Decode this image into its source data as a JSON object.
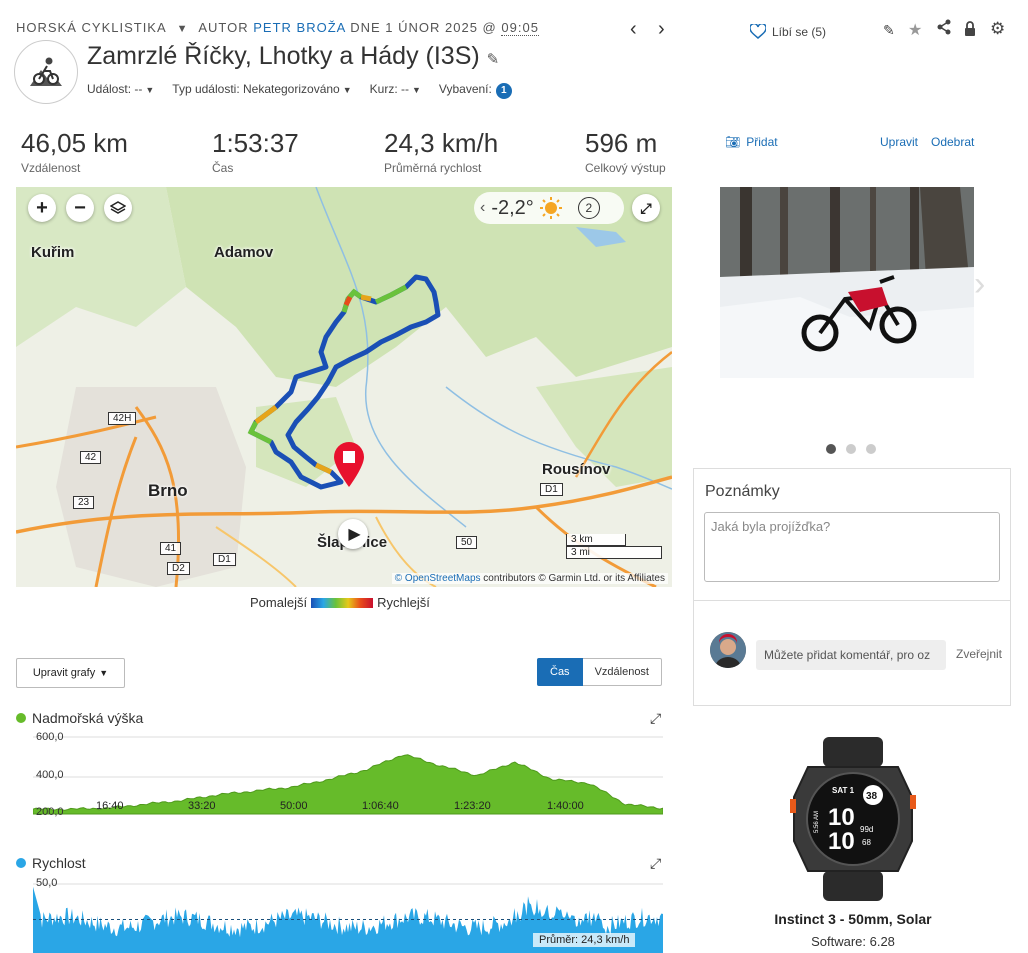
{
  "header": {
    "activity_type": "HORSKÁ CYKLISTIKA",
    "author_prefix": "AUTOR",
    "author_name": "PETR BROŽA",
    "date_text": "DNE 1 ÚNOR 2025 @",
    "time": "09:05",
    "title": "Zamrzlé Říčky, Lhotky a Hády (I3S)",
    "event_label": "Událost: --",
    "event_type_label": "Typ události: Nekategorizováno",
    "course_label": "Kurz: --",
    "gear_label": "Vybavení:",
    "gear_count": "1"
  },
  "stats": [
    {
      "value": "46,05 km",
      "label": "Vzdálenost"
    },
    {
      "value": "1:53:37",
      "label": "Čas"
    },
    {
      "value": "24,3 km/h",
      "label": "Průměrná rychlost"
    },
    {
      "value": "596 m",
      "label": "Celkový výstup"
    }
  ],
  "map": {
    "temperature": "-2,2°",
    "wind_level": "2",
    "places": [
      "Kuřim",
      "Adamov",
      "Brno",
      "Rousínov",
      "Šlapanice"
    ],
    "roads": [
      "42H",
      "42",
      "23",
      "41",
      "D2",
      "D1",
      "50",
      "D1"
    ],
    "scale_km": "3 km",
    "scale_mi": "3 mi",
    "attribution_link": "© OpenStreetMaps",
    "attribution_rest": "contributors © Garmin Ltd. or its Affiliates",
    "legend_slow": "Pomalejší",
    "legend_fast": "Rychlejší"
  },
  "charts_controls": {
    "edit_label": "Upravit grafy",
    "toggle_time": "Čas",
    "toggle_distance": "Vzdálenost"
  },
  "colors": {
    "accent": "#1a6db5",
    "elevation": "#66bb2a",
    "speed": "#2aa6e6",
    "marker": "#e8112d"
  },
  "elevation_chart": {
    "title": "Nadmořská výška",
    "y_ticks": [
      "600,0",
      "400,0",
      "200,0"
    ],
    "x_ticks": [
      "16:40",
      "33:20",
      "50:00",
      "1:06:40",
      "1:23:20",
      "1:40:00"
    ]
  },
  "speed_chart": {
    "title": "Rychlost",
    "y_top": "50,0",
    "average_label": "Průměr: 24,3 km/h"
  },
  "chart_data": [
    {
      "type": "area",
      "title": "Nadmořská výška",
      "ylim": [
        200,
        600
      ],
      "x": [
        "0:00",
        "6:40",
        "13:20",
        "20:00",
        "26:40",
        "33:20",
        "40:00",
        "46:40",
        "53:20",
        "60:00",
        "66:40",
        "73:20",
        "80:00",
        "86:40",
        "93:20",
        "100:00",
        "106:40",
        "113:37"
      ],
      "values": [
        225,
        225,
        230,
        250,
        270,
        300,
        320,
        340,
        380,
        430,
        510,
        450,
        400,
        470,
        380,
        360,
        250,
        230
      ]
    },
    {
      "type": "area",
      "title": "Rychlost",
      "ylim": [
        0,
        50
      ],
      "average": 24.3
    }
  ],
  "sidebar": {
    "likes_label": "Líbí se (5)",
    "add_photo": "Přidat",
    "edit": "Upravit",
    "remove": "Odebrat",
    "notes_title": "Poznámky",
    "notes_placeholder": "Jaká byla projížďka?",
    "comment_placeholder": "Můžete přidat komentář, pro oz",
    "publish": "Zveřejnit",
    "device_name": "Instinct 3 - 50mm, Solar",
    "software": "Software: 6.28",
    "watch_face": {
      "day": "SAT 1",
      "time_hour": "10",
      "time_min": "10",
      "ring": "38",
      "stat": "99d",
      "hr": "68",
      "side": "5:56 AM"
    }
  }
}
